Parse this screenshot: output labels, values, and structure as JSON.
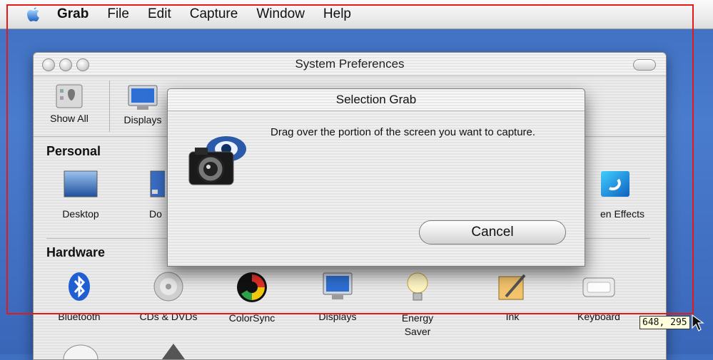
{
  "menubar": {
    "app_name": "Grab",
    "items": [
      "File",
      "Edit",
      "Capture",
      "Window",
      "Help"
    ]
  },
  "window": {
    "title": "System Preferences",
    "toolbar": {
      "show_all": "Show All",
      "displays": "Displays"
    },
    "sections": {
      "personal": {
        "label": "Personal",
        "items": [
          "Desktop",
          "Do",
          "en Effects"
        ]
      },
      "hardware": {
        "label": "Hardware",
        "items": [
          "Bluetooth",
          "CDs & DVDs",
          "ColorSync",
          "Displays",
          "Energy Saver",
          "Ink",
          "Keyboard"
        ]
      }
    }
  },
  "dialog": {
    "title": "Selection Grab",
    "message": "Drag over the portion of the screen you want to capture.",
    "cancel_label": "Cancel"
  },
  "selection": {
    "coordinates": "648, 295",
    "color": "#e21a1a"
  }
}
